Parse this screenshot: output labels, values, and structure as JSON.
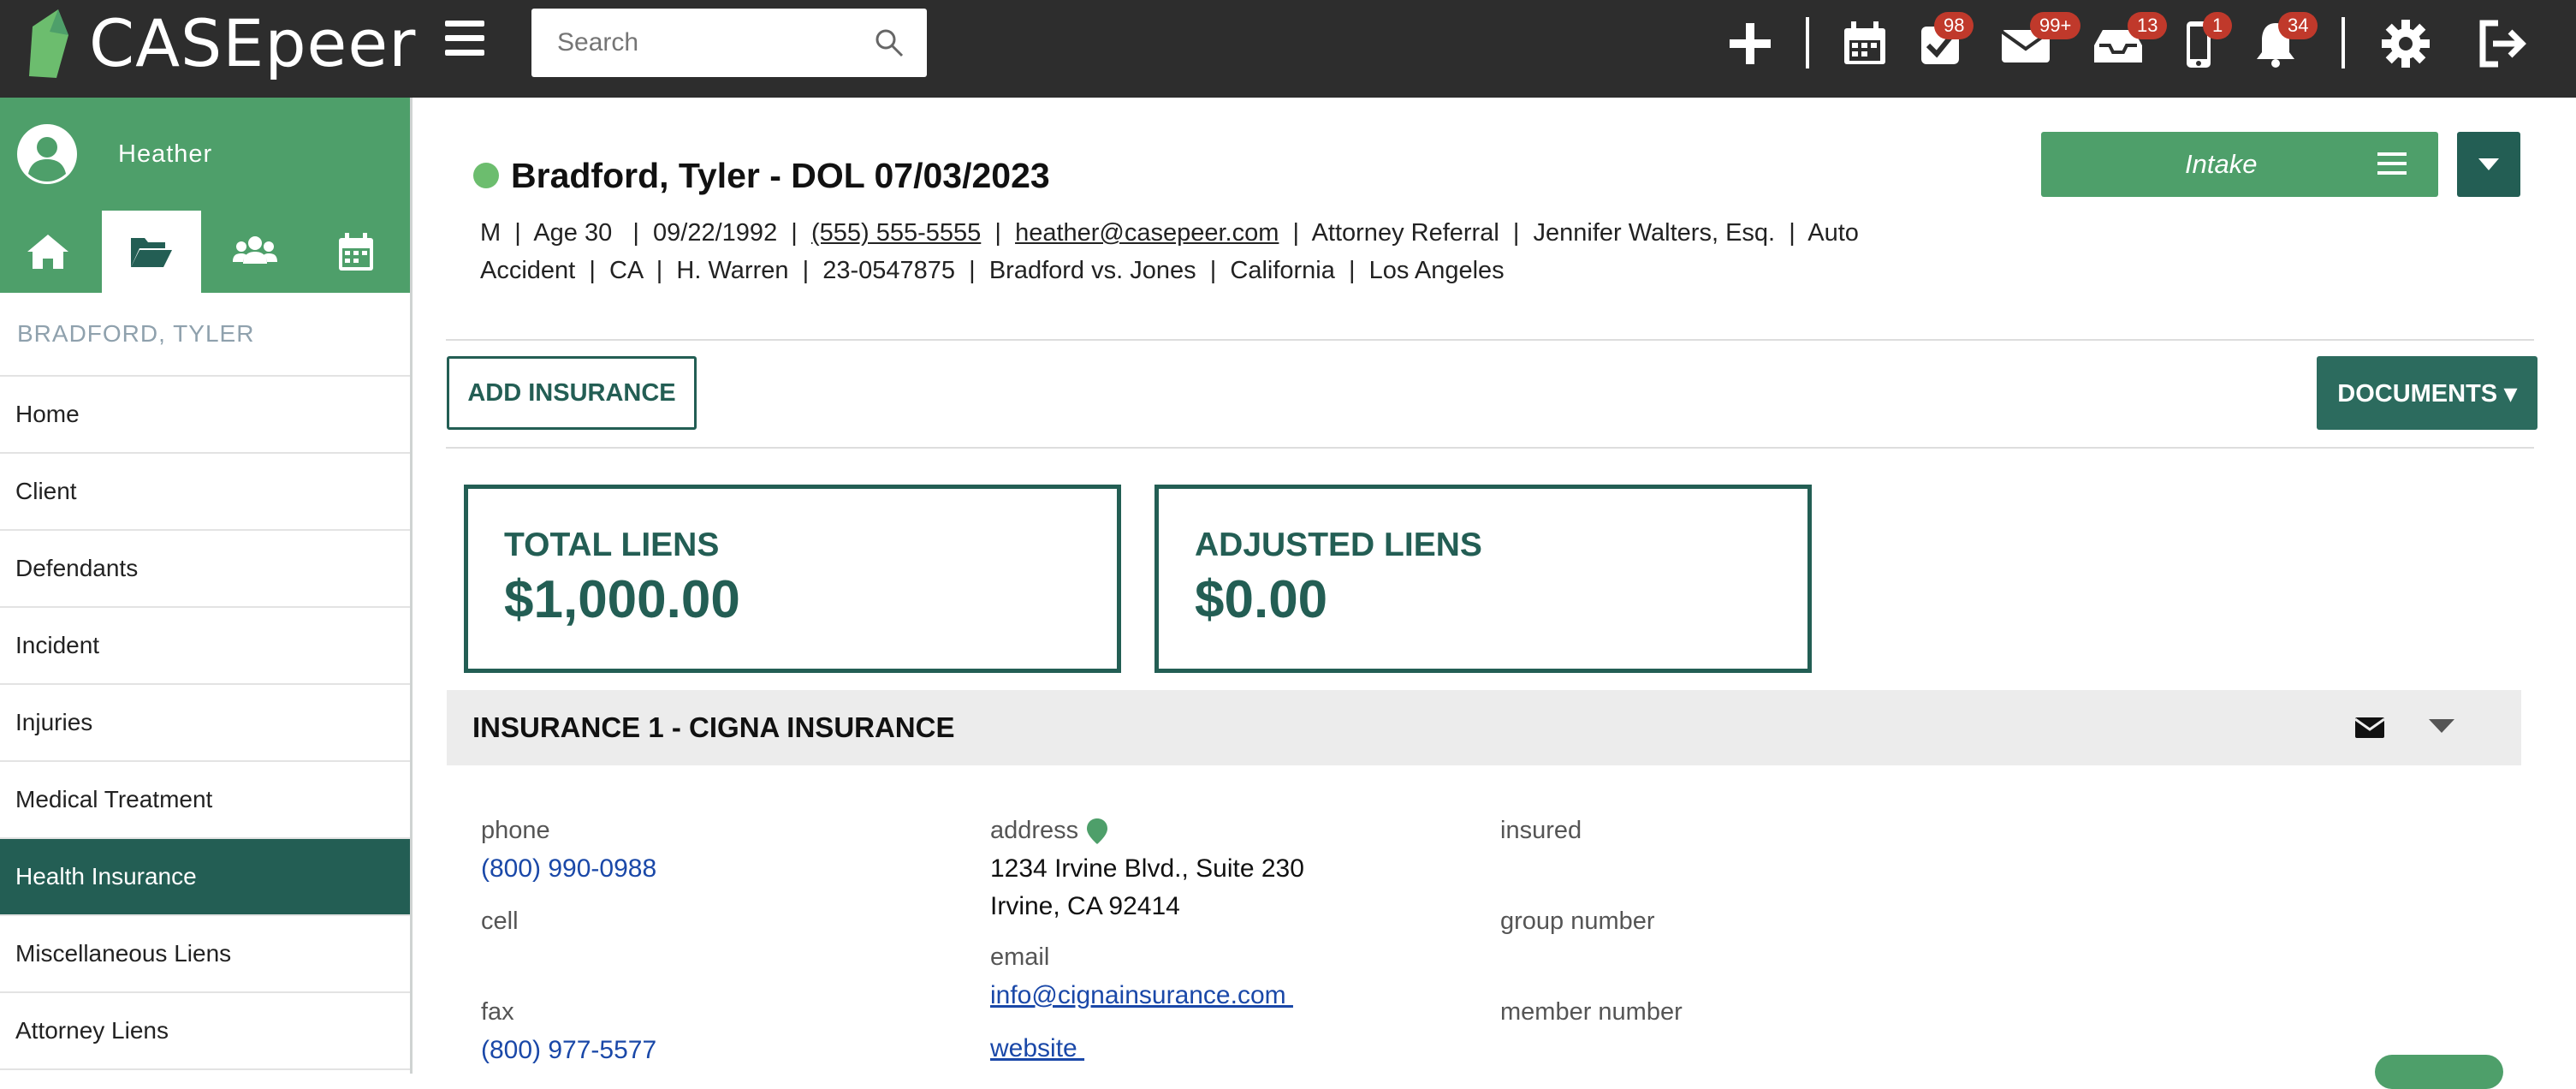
{
  "topbar": {
    "logo_text": "CASEpeer",
    "search_placeholder": "Search",
    "badges": {
      "tasks": "98",
      "mail": "99+",
      "inbox": "13",
      "phone": "1",
      "notifications": "34"
    }
  },
  "sidebar": {
    "user_name": "Heather",
    "case_label": "BRADFORD, TYLER",
    "items": [
      {
        "label": "Home"
      },
      {
        "label": "Client"
      },
      {
        "label": "Defendants"
      },
      {
        "label": "Incident"
      },
      {
        "label": "Injuries"
      },
      {
        "label": "Medical Treatment"
      },
      {
        "label": "Health Insurance"
      },
      {
        "label": "Miscellaneous Liens"
      },
      {
        "label": "Attorney Liens"
      }
    ]
  },
  "case": {
    "title": "Bradford, Tyler - DOL 07/03/2023",
    "line1_a": "M  |  Age 30   |  09/22/1992  |  ",
    "phone": "(555) 555-5555",
    "sep1": "  |  ",
    "email": "heather@casepeer.com",
    "line1_b": "  |  Attorney Referral  |  Jennifer Walters, Esq.  |  Auto",
    "line2": "Accident  |  CA  |  H. Warren  |  23-0547875  |  Bradford vs. Jones  |  California  |  Los Angeles"
  },
  "actions": {
    "intake_label": "Intake",
    "add_insurance_label": "ADD INSURANCE",
    "documents_label": "DOCUMENTS ▾"
  },
  "liens": {
    "total_title": "TOTAL LIENS",
    "total_value": "$1,000.00",
    "adjusted_title": "ADJUSTED LIENS",
    "adjusted_value": "$0.00"
  },
  "insurance": {
    "title": "INSURANCE 1 - CIGNA INSURANCE",
    "phone_label": "phone",
    "phone_value": "(800) 990-0988",
    "cell_label": "cell",
    "fax_label": "fax",
    "fax_value": "(800) 977-5577",
    "address_label": "address",
    "address_line1": "1234 Irvine Blvd., Suite 230",
    "address_line2": "Irvine, CA 92414",
    "email_label": "email",
    "email_value": "info@cignainsurance.com ",
    "website_label": "website ",
    "insured_label": "insured",
    "group_label": "group number",
    "member_label": "member number"
  },
  "colors": {
    "primary_green": "#4e9f6a",
    "dark_teal": "#235e54",
    "topbar": "#2d2d2d",
    "badge": "#c0392b"
  }
}
